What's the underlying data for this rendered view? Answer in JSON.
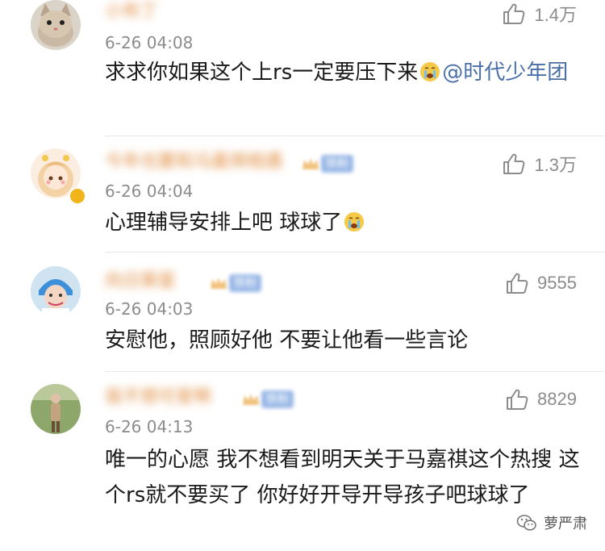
{
  "comments": [
    {
      "name": "小布丁",
      "fan_badge": "",
      "time": "6-26 04:08",
      "likes": "1.4万",
      "text_before": "求求你如果这个上rs一定要压下来",
      "emoji": "crying-face-icon",
      "mention": "@时代少年团",
      "text_after": ""
    },
    {
      "name": "今年也要和马嘉祺相遇",
      "fan_badge": "铁粉",
      "time": "6-26 04:04",
      "likes": "1.3万",
      "text_before": "心理辅导安排上吧 球球了",
      "emoji": "crying-face-icon",
      "mention": "",
      "text_after": ""
    },
    {
      "name": "向日葵星",
      "fan_badge": "铁粉",
      "time": "6-26 04:03",
      "likes": "9555",
      "text_before": "安慰他，照顾好他 不要让他看一些言论",
      "emoji": "",
      "mention": "",
      "text_after": ""
    },
    {
      "name": "我不想可爱啊",
      "fan_badge": "铁粉",
      "time": "6-26 04:13",
      "likes": "8829",
      "text_before": "唯一的心愿 我不想看到明天关于马嘉祺这个热搜 这个rs就不要买了 你好好开导开导孩子吧球球了",
      "emoji": "",
      "mention": "",
      "text_after": ""
    }
  ],
  "watermark": {
    "label": "萝严肃",
    "icon": "wechat-icon"
  },
  "colors": {
    "mention": "#4a6fa8",
    "timestamp": "#8c8c8c",
    "name": "#e08a3c",
    "badge": "#9ab8e6"
  }
}
